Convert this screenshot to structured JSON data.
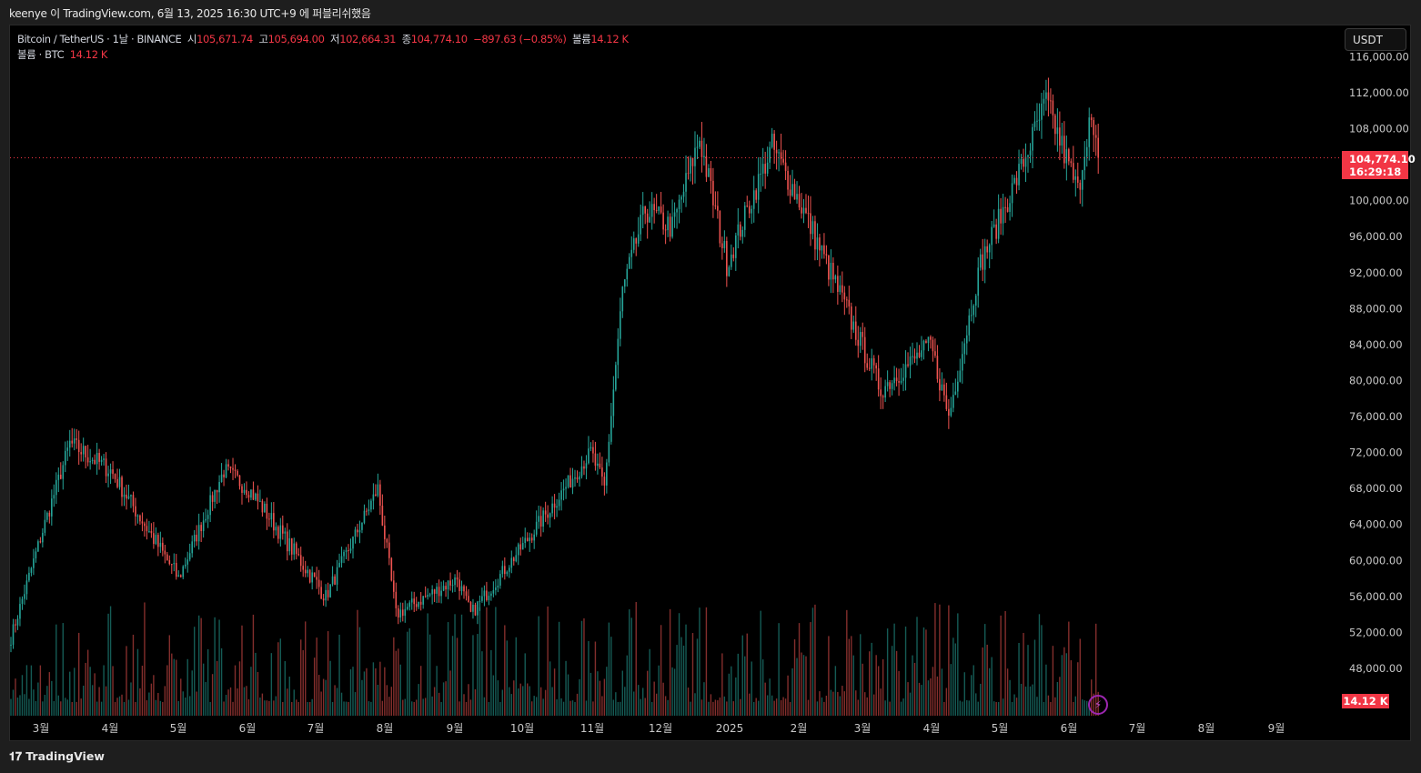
{
  "publish_line": "keenye 이 TradingView.com, 6월 13, 2025 16:30 UTC+9 에 퍼블리쉬했음",
  "legend": {
    "symbol": "Bitcoin / TetherUS · 1날 · BINANCE",
    "open_label": "시",
    "open": "105,671.74",
    "high_label": "고",
    "high": "105,694.00",
    "low_label": "저",
    "low": "102,664.31",
    "close_label": "종",
    "close": "104,774.10",
    "change": "−897.63 (−0.85%)",
    "vol_label": "볼륨",
    "vol": "14.12 K",
    "vol_line_label": "볼륨 · BTC",
    "vol_line_value": "14.12 K"
  },
  "currency_button": "USDT",
  "last_price": "104,774.10",
  "countdown": "16:29:18",
  "volume_tag": "14.12 K",
  "footer_brand": "TradingView",
  "colors": {
    "up": "#26a69a",
    "down": "#ef5350",
    "tag": "#f23645"
  },
  "chart_data": {
    "type": "bar",
    "title": "Bitcoin / TetherUS · 1날 · BINANCE",
    "ylim": [
      44000,
      117000
    ],
    "y_ticks": [
      "116,000.00",
      "112,000.00",
      "108,000.00",
      "100,000.00",
      "96,000.00",
      "92,000.00",
      "88,000.00",
      "84,000.00",
      "80,000.00",
      "76,000.00",
      "72,000.00",
      "68,000.00",
      "64,000.00",
      "60,000.00",
      "56,000.00",
      "52,000.00",
      "48,000.00"
    ],
    "y_tick_values": [
      116000,
      112000,
      108000,
      100000,
      96000,
      92000,
      88000,
      84000,
      80000,
      76000,
      72000,
      68000,
      64000,
      60000,
      56000,
      52000,
      48000
    ],
    "x_ticks": [
      "3월",
      "4월",
      "5월",
      "6월",
      "7월",
      "8월",
      "9월",
      "10월",
      "11월",
      "12월",
      "2025",
      "2월",
      "3월",
      "4월",
      "5월",
      "6월",
      "7월",
      "8월",
      "9월"
    ],
    "close_path_daily_index": [
      [
        0,
        51400
      ],
      [
        13,
        62500
      ],
      [
        26,
        73000
      ],
      [
        44,
        70000
      ],
      [
        74,
        58000
      ],
      [
        94,
        70000
      ],
      [
        105,
        68000
      ],
      [
        139,
        56000
      ],
      [
        162,
        68000
      ],
      [
        170,
        54000
      ],
      [
        197,
        58000
      ],
      [
        203,
        54000
      ],
      [
        227,
        62000
      ],
      [
        256,
        72000
      ],
      [
        262,
        68000
      ],
      [
        270,
        90000
      ],
      [
        280,
        99000
      ],
      [
        292,
        97000
      ],
      [
        304,
        107000
      ],
      [
        316,
        93000
      ],
      [
        336,
        106000
      ],
      [
        348,
        100000
      ],
      [
        372,
        86000
      ],
      [
        384,
        79000
      ],
      [
        406,
        84000
      ],
      [
        414,
        76000
      ],
      [
        428,
        93000
      ],
      [
        445,
        103000
      ],
      [
        457,
        111000
      ],
      [
        471,
        101000
      ],
      [
        476,
        109000
      ],
      [
        480,
        104774
      ]
    ]
  }
}
